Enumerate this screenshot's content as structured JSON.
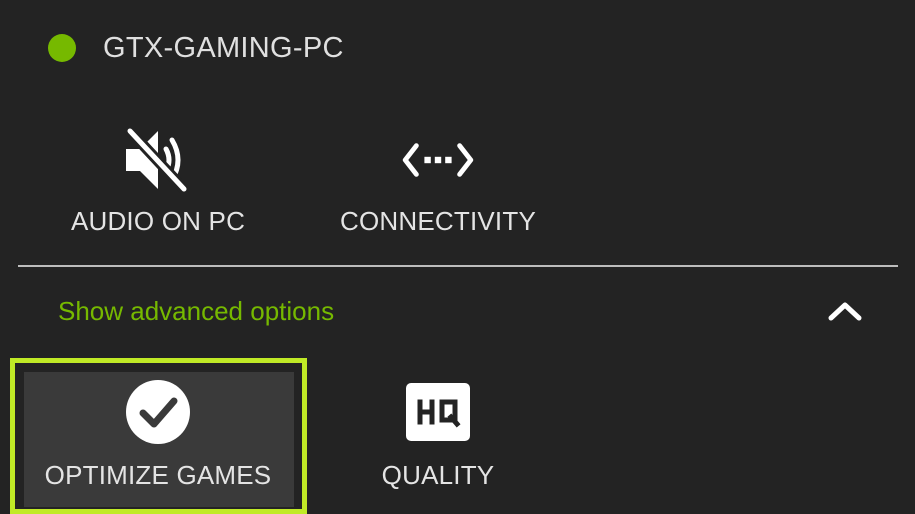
{
  "header": {
    "status_color": "#76b900",
    "pc_name": "GTX-GAMING-PC"
  },
  "tiles": [
    {
      "label": "AUDIO ON PC",
      "icon": "speaker-muted-icon"
    },
    {
      "label": "CONNECTIVITY",
      "icon": "connectivity-icon"
    }
  ],
  "advanced": {
    "label": "Show advanced options",
    "expanded": true,
    "accent_color": "#76b900"
  },
  "advanced_tiles": [
    {
      "label": "OPTIMIZE GAMES",
      "icon": "checkmark-circle-icon",
      "focused": true
    },
    {
      "label": "QUALITY",
      "icon": "hq-icon"
    }
  ],
  "focus_color": "#c0ea26"
}
